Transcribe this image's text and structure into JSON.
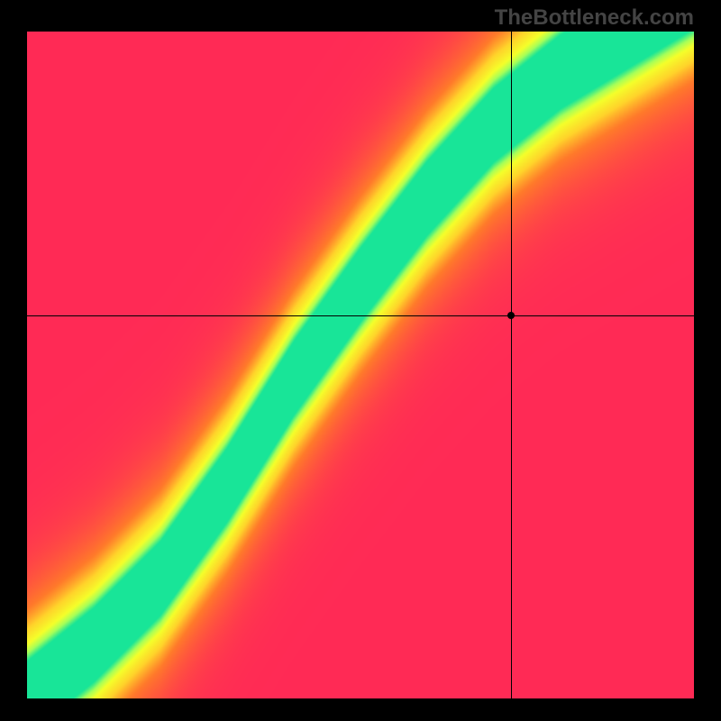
{
  "watermark": "TheBottleneck.com",
  "chart_data": {
    "type": "heatmap",
    "title": "",
    "xlabel": "",
    "ylabel": "",
    "xlim": [
      0,
      1
    ],
    "ylim": [
      0,
      1
    ],
    "crosshair": {
      "x": 0.725,
      "y": 0.575
    },
    "marker": {
      "x": 0.725,
      "y": 0.575
    },
    "ridge_curve": [
      {
        "x": 0.0,
        "y": 0.0
      },
      {
        "x": 0.1,
        "y": 0.08
      },
      {
        "x": 0.2,
        "y": 0.18
      },
      {
        "x": 0.3,
        "y": 0.32
      },
      {
        "x": 0.4,
        "y": 0.48
      },
      {
        "x": 0.5,
        "y": 0.62
      },
      {
        "x": 0.6,
        "y": 0.75
      },
      {
        "x": 0.7,
        "y": 0.86
      },
      {
        "x": 0.8,
        "y": 0.94
      },
      {
        "x": 0.9,
        "y": 1.0
      }
    ],
    "color_stops": [
      {
        "t": 0.0,
        "color": "#ff2a55"
      },
      {
        "t": 0.35,
        "color": "#ff7a2a"
      },
      {
        "t": 0.55,
        "color": "#ffd42a"
      },
      {
        "t": 0.75,
        "color": "#f5ff2a"
      },
      {
        "t": 0.88,
        "color": "#a5ff5a"
      },
      {
        "t": 1.0,
        "color": "#18e598"
      }
    ],
    "ridge_halfwidth": 0.055,
    "falloff": 2.2
  }
}
